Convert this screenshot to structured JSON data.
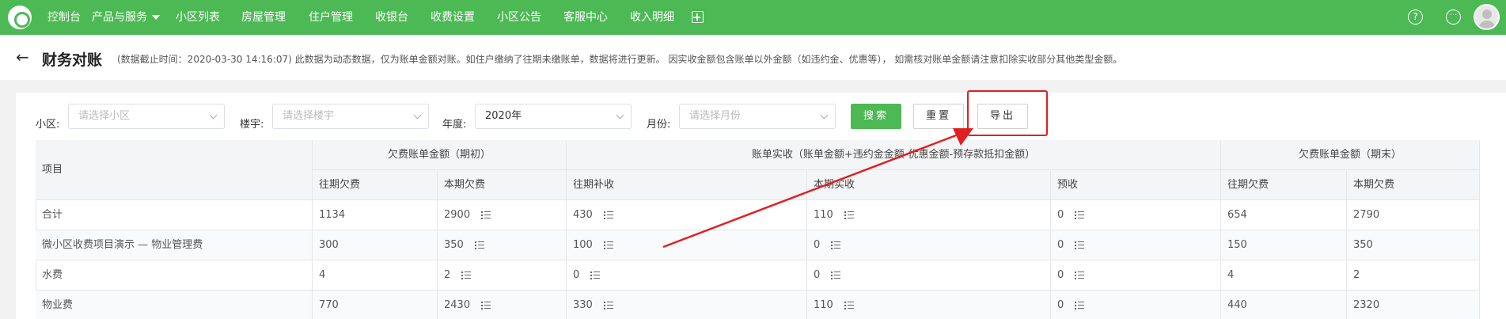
{
  "nav": {
    "items": [
      {
        "label": "控制台"
      },
      {
        "label": "产品与服务"
      },
      {
        "label": "小区列表"
      },
      {
        "label": "房屋管理"
      },
      {
        "label": "住户管理"
      },
      {
        "label": "收银台"
      },
      {
        "label": "收费设置"
      },
      {
        "label": "小区公告"
      },
      {
        "label": "客服中心"
      },
      {
        "label": "收入明细"
      }
    ],
    "help_glyph": "?",
    "chat_glyph": "···"
  },
  "header": {
    "back_glyph": "←",
    "title": "财务对账",
    "note": "(数据截止时间：2020-03-30 14:16:07)  此数据为动态数据，仅为账单金额对账。如住户缴纳了往期未缴账单，数据将进行更新。 因实收金额包含账单以外金额（如违约金、优惠等）， 如需核对账单金额请注意扣除实收部分其他类型金额。"
  },
  "filters": {
    "community_label": "小区:",
    "community_placeholder": "请选择小区",
    "building_label": "楼宇:",
    "building_placeholder": "请选择楼宇",
    "year_label": "年度:",
    "year_value": "2020年",
    "month_label": "月份:",
    "month_placeholder": "请选择月份",
    "search_label": "搜索",
    "reset_label": "重置",
    "export_label": "导出"
  },
  "table": {
    "item_header": "项目",
    "group_headers": [
      "欠费账单金额（期初）",
      "账单实收（账单金额+违约金金额-优惠金额-预存款抵扣金额）",
      "欠费账单金额（期末）"
    ],
    "sub_headers": [
      "往期欠费",
      "本期欠费",
      "往期补收",
      "本期实收",
      "预收",
      "往期欠费",
      "本期欠费"
    ],
    "rows": [
      {
        "name": "合计",
        "values": [
          "1134",
          "2900",
          "430",
          "110",
          "0",
          "654",
          "2790"
        ]
      },
      {
        "name": "微小区收费项目演示 — 物业管理费",
        "values": [
          "300",
          "350",
          "100",
          "0",
          "0",
          "150",
          "350"
        ]
      },
      {
        "name": "水费",
        "values": [
          "4",
          "2",
          "0",
          "0",
          "0",
          "4",
          "2"
        ]
      },
      {
        "name": "物业费",
        "values": [
          "770",
          "2430",
          "330",
          "110",
          "0",
          "440",
          "2320"
        ]
      }
    ]
  },
  "colors": {
    "brand_green": "#4cb954",
    "annotation_red": "#e02020"
  }
}
